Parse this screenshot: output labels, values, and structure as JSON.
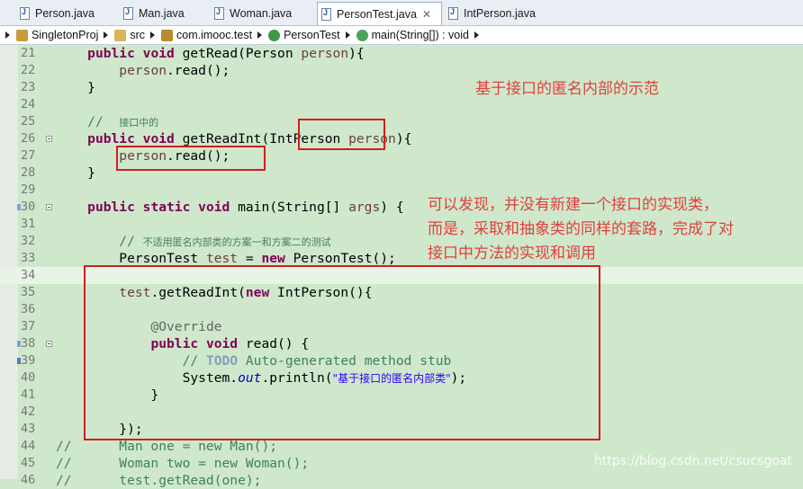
{
  "tabs": [
    {
      "label": "Person.java",
      "active": false
    },
    {
      "label": "Man.java",
      "active": false
    },
    {
      "label": "Woman.java",
      "active": false
    },
    {
      "label": "PersonTest.java",
      "active": true,
      "close": "✕"
    },
    {
      "label": "IntPerson.java",
      "active": false
    }
  ],
  "breadcrumb": [
    "SingletonProj",
    "src",
    "com.imooc.test",
    "PersonTest",
    "main(String[]) : void"
  ],
  "annotations": {
    "title": "基于接口的匿名内部的示范",
    "explain_line1": "可以发现，并没有新建一个接口的实现类，",
    "explain_line2": "而是，采取和抽象类的同样的套路，完成了对",
    "explain_line3": "接口中方法的实现和调用",
    "color": "#e0403c",
    "box_color": "#d21d1d"
  },
  "watermark": "https://blog.csdn.net/csucsgoat",
  "code": {
    "line_numbers": [
      "21",
      "22",
      "23",
      "24",
      "25",
      "26",
      "27",
      "28",
      "29",
      "30",
      "31",
      "32",
      "33",
      "34",
      "35",
      "36",
      "37",
      "38",
      "39",
      "40",
      "41",
      "42",
      "43",
      "44",
      "45",
      "46"
    ],
    "l21_kw": "public void",
    "l21_a": " getRead(Person ",
    "l21_prm": "person",
    "l21_b": "){",
    "l22_prm": "person",
    "l22_a": ".read();",
    "l23": "}",
    "l25_cm": "//  ",
    "l25_cj": "接口中的",
    "l26_kw": "public void",
    "l26_a": " getReadInt(IntPerson ",
    "l26_prm": "person",
    "l26_b": "){",
    "l27_prm": "person",
    "l27_a": ".read();",
    "l28": "}",
    "l30_kw": "public static void",
    "l30_a": " main(String[] ",
    "l30_prm": "args",
    "l30_b": ") {",
    "l32_cm": "// ",
    "l32_cj": "不适用匿名内部类的方案一和方案二的测试",
    "l33_a": "PersonTest ",
    "l33_prm": "test",
    "l33_b": " = ",
    "l33_kw": "new",
    "l33_c": " PersonTest();",
    "l35_prm": "test",
    "l35_a": ".getReadInt(",
    "l35_kw": "new",
    "l35_b": " IntPerson(){",
    "l37_ann": "@Override",
    "l38_kw": "public void",
    "l38_a": " read() {",
    "l39_cm1": "// ",
    "l39_todo": "TODO",
    "l39_cm2": " Auto-generated method stub",
    "l40_a": "System.",
    "l40_fld": "out",
    "l40_b": ".println(",
    "l40_st": "\"基于接口的匿名内部类\"",
    "l40_c": ");",
    "l41": "}",
    "l43": "});",
    "l44": "//      Man one = new Man();",
    "l45": "//      Woman two = new Woman();",
    "l46": "//      test.getRead(one);"
  }
}
